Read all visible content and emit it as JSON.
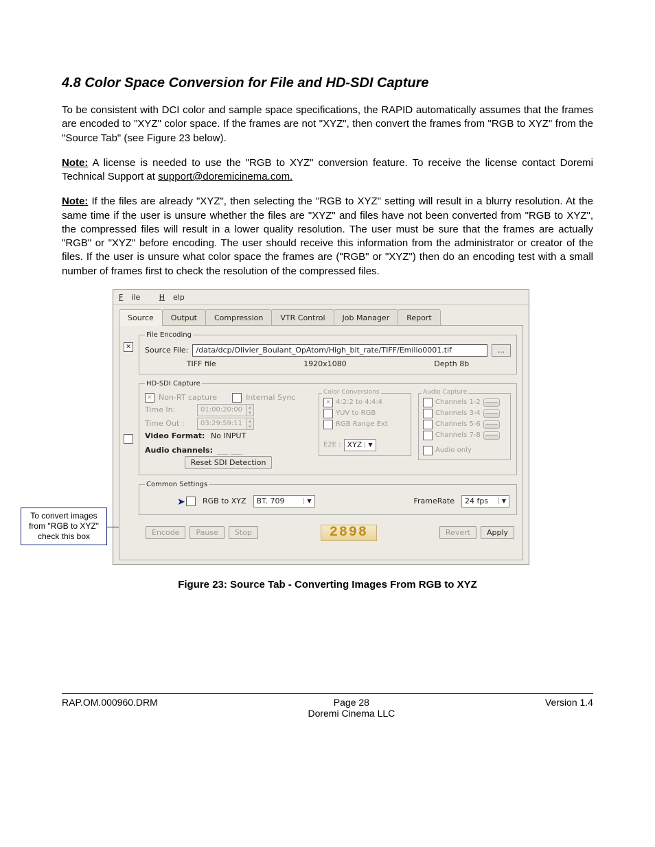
{
  "heading": "4.8  Color Space Conversion for File and HD-SDI Capture",
  "para1": "To be consistent with DCI color and sample space specifications, the RAPID automatically assumes that the frames are encoded to \"XYZ\" color space. If the frames are not \"XYZ\", then convert the frames from \"RGB to XYZ\" from the \"Source Tab\" (see Figure 23 below).",
  "note1_label": "Note:",
  "note1_text": " A license is needed to use the \"RGB to XYZ\" conversion feature. To receive the license contact Doremi Technical Support at ",
  "note1_email": "support@doremicinema.com.",
  "note2_label": "Note:",
  "note2_text": " If the files are already \"XYZ\", then selecting the \"RGB to XYZ\" setting will result in a blurry resolution. At the same time if the user is unsure whether the files are \"XYZ\" and files have not been converted from \"RGB to XYZ\", the compressed files will result in a lower quality resolution. The user must be sure that the frames are actually \"RGB\" or \"XYZ\" before encoding. The user should receive this information from the administrator or creator of the files. If the user is unsure what color space the frames are (\"RGB\" or \"XYZ\") then do an encoding test with a small number of frames first to check the resolution of the compressed files.",
  "callout": "To convert images from \"RGB to XYZ\" check this box",
  "app": {
    "menu": {
      "file": "File",
      "help": "Help"
    },
    "tabs": [
      "Source",
      "Output",
      "Compression",
      "VTR Control",
      "Job Manager",
      "Report"
    ],
    "file_encoding": {
      "legend": "File Encoding",
      "source_label": "Source File:",
      "source_value": "/data/dcp/Olivier_Boulant_OpAtom/High_bit_rate/TIFF/Emilio0001.tif",
      "browse": "...",
      "filetype": "TIFF file",
      "resolution": "1920x1080",
      "depth": "Depth 8b"
    },
    "hdsdi": {
      "legend": "HD-SDI Capture",
      "nonrt": "Non-RT capture",
      "internal_sync": "Internal Sync",
      "time_in_label": "Time In:",
      "time_in_value": "01:00:20:00",
      "time_out_label": "Time Out :",
      "time_out_value": "03:29:59:11",
      "video_format_label": "Video Format:",
      "video_format_value": "No INPUT",
      "audio_channels_label": "Audio channels:",
      "reset_btn": "Reset SDI Detection",
      "color_conv": {
        "legend": "Color Conversions",
        "c1": "4:2:2 to 4:4:4",
        "c2": "YUV to RGB",
        "c3": "RGB Range Ext",
        "e2e_label": "E2E :",
        "e2e_value": "XYZ"
      },
      "audio_capture": {
        "legend": "Audio Capture",
        "ch12": "Channels 1-2",
        "ch34": "Channels 3-4",
        "ch56": "Channels 5-6",
        "ch78": "Channels 7-8",
        "audio_only": "Audio only"
      }
    },
    "common": {
      "legend": "Common Settings",
      "rgb_to_xyz": "RGB to XYZ",
      "bt709": "BT. 709",
      "framerate_label": "FrameRate",
      "framerate_value": "24 fps"
    },
    "bottom": {
      "encode": "Encode",
      "pause": "Pause",
      "stop": "Stop",
      "lcd": "2898",
      "revert": "Revert",
      "apply": "Apply"
    }
  },
  "caption": "Figure 23: Source Tab - Converting Images From RGB to XYZ",
  "footer": {
    "left": "RAP.OM.000960.DRM",
    "center1": "Page ",
    "center_num": "28",
    "center2": "Doremi Cinema LLC",
    "right": "Version 1.4"
  }
}
